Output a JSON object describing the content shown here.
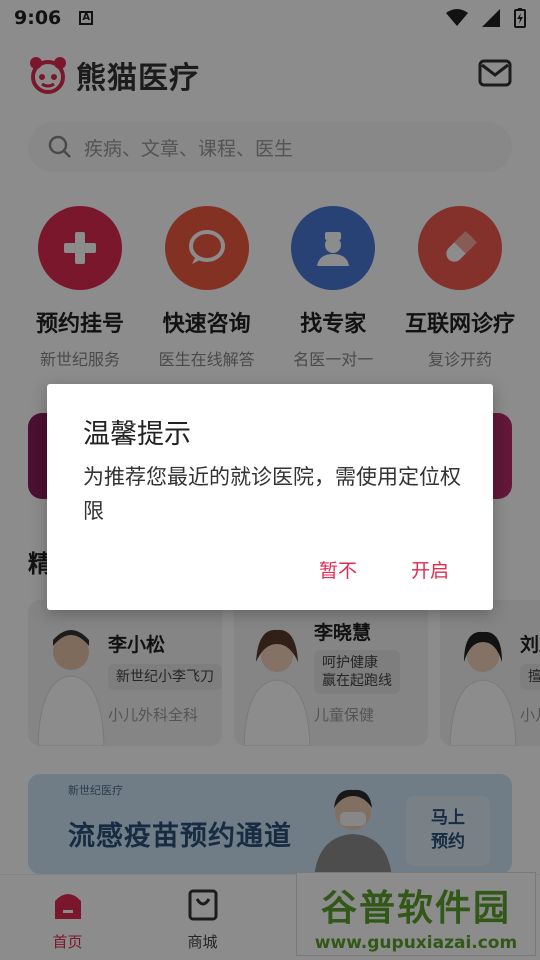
{
  "status_bar": {
    "time": "9:06",
    "a_icon": "A"
  },
  "header": {
    "title": "熊猫医疗"
  },
  "search": {
    "placeholder": "疾病、文章、课程、医生"
  },
  "services": [
    {
      "name": "预约挂号",
      "sub": "新世纪服务",
      "color": "#e02b50",
      "icon": "plus-icon"
    },
    {
      "name": "快速咨询",
      "sub": "医生在线解答",
      "color": "#ef5a3e",
      "icon": "chat-icon"
    },
    {
      "name": "找专家",
      "sub": "名医一对一",
      "color": "#4a78d8",
      "icon": "doctor-icon"
    },
    {
      "name": "互联网诊疗",
      "sub": "复诊开药",
      "color": "#ef5a4e",
      "icon": "pill-icon"
    }
  ],
  "section_title": "精",
  "doctors": [
    {
      "name": "李小松",
      "tag": "新世纪小李飞刀",
      "dept": "小儿外科全科"
    },
    {
      "name": "李晓慧",
      "tag": "呵护健康\n赢在起跑线",
      "dept": "儿童保健"
    },
    {
      "name": "刘亚",
      "tag": "擅长",
      "dept": "小儿"
    }
  ],
  "flu_banner": {
    "brand": "新世纪医疗",
    "text": "流感疫苗预约通道",
    "button": "马上\n预约"
  },
  "tabbar": {
    "home": "首页",
    "mall": "商城"
  },
  "watermark": {
    "big": "谷普软件园",
    "small": "www.gupuxiazai.com"
  },
  "dialog": {
    "title": "温馨提示",
    "message": "为推荐您最近的就诊医院，需使用定位权限",
    "cancel": "暂不",
    "confirm": "开启"
  },
  "colors": {
    "accent": "#e02b50",
    "overlay": "rgba(0,0,0,0.45)"
  }
}
